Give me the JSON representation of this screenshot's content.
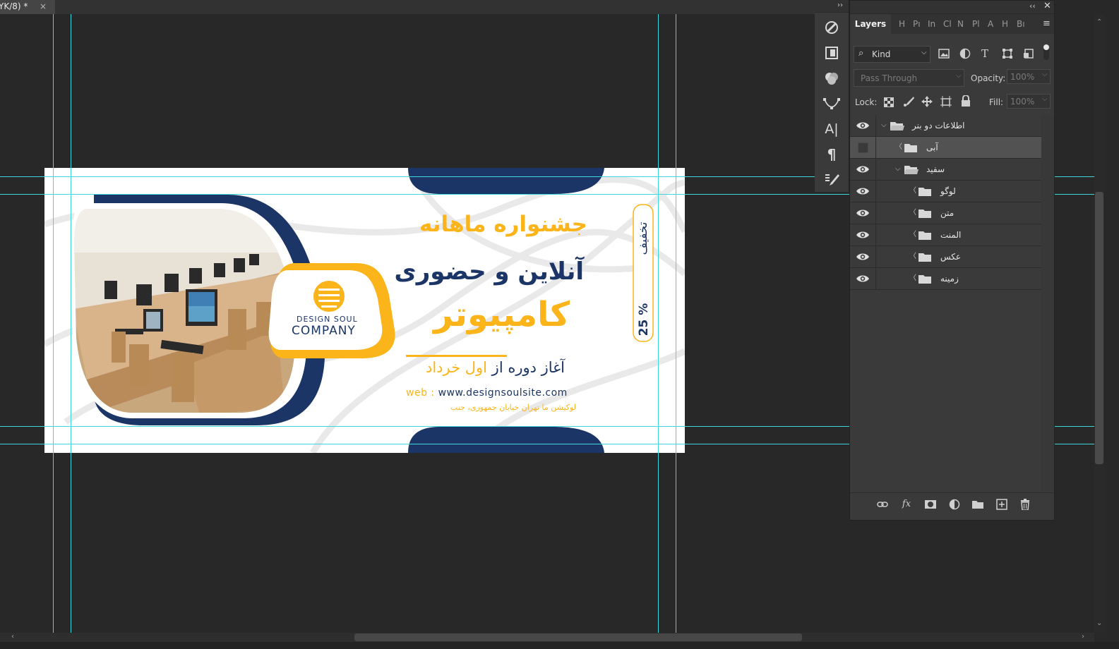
{
  "document_tab": {
    "title": "YK/8) *",
    "close": "×"
  },
  "banner": {
    "headline": "جشنواره ماهانه",
    "subheadline": "آنلاین و حضوری",
    "main_word": "کامپیوتر",
    "start_prefix": "آغاز دوره از",
    "start_highlight": "اول خرداد",
    "web_label": "web :",
    "web_url": "www.designsoulsite.com",
    "location": "لوکیشن ما تهران خیابان جمهوری، جنب",
    "logo_top": "DESIGN SOUL",
    "logo_bottom": "COMPANY",
    "discount_word": "تخفیف",
    "discount_value": "25 %",
    "colors": {
      "navy": "#1b3566",
      "gold": "#fbb41a"
    }
  },
  "tools": [
    {
      "icon": "adjust-icon"
    },
    {
      "icon": "library-icon"
    },
    {
      "icon": "color-icon"
    },
    {
      "icon": "pen-path-icon"
    },
    {
      "icon": "character-icon",
      "glyph": "A|"
    },
    {
      "icon": "paragraph-icon",
      "glyph": "¶"
    },
    {
      "icon": "brush-settings-icon"
    }
  ],
  "layers_panel": {
    "tab_label": "Layers",
    "mini_tabs": [
      "H",
      "Pı",
      "In",
      "Cl",
      "N",
      "Pl",
      "A",
      "H",
      "Bı"
    ],
    "filter_label": "Kind",
    "blend_mode": "Pass Through",
    "opacity_label": "Opacity:",
    "opacity_value": "100%",
    "lock_label": "Lock:",
    "fill_label": "Fill:",
    "fill_value": "100%",
    "layers": [
      {
        "name": "اطلاعات دو بنر",
        "visible": true,
        "expanded": true,
        "indent": 0,
        "selected": false
      },
      {
        "name": "آبی",
        "visible": false,
        "expanded": false,
        "indent": 1,
        "selected": true
      },
      {
        "name": "سفید",
        "visible": true,
        "expanded": true,
        "indent": 1,
        "selected": false
      },
      {
        "name": "لوگو",
        "visible": true,
        "expanded": false,
        "indent": 2,
        "selected": false
      },
      {
        "name": "متن",
        "visible": true,
        "expanded": false,
        "indent": 2,
        "selected": false
      },
      {
        "name": "المنت",
        "visible": true,
        "expanded": false,
        "indent": 2,
        "selected": false
      },
      {
        "name": "عکس",
        "visible": true,
        "expanded": false,
        "indent": 2,
        "selected": false
      },
      {
        "name": "زمینه",
        "visible": true,
        "expanded": false,
        "indent": 2,
        "selected": false
      }
    ],
    "footer_icons": [
      "link-icon",
      "fx-icon",
      "mask-icon",
      "adjustment-icon",
      "group-icon",
      "new-layer-icon",
      "trash-icon"
    ],
    "fx_label": "fx"
  }
}
